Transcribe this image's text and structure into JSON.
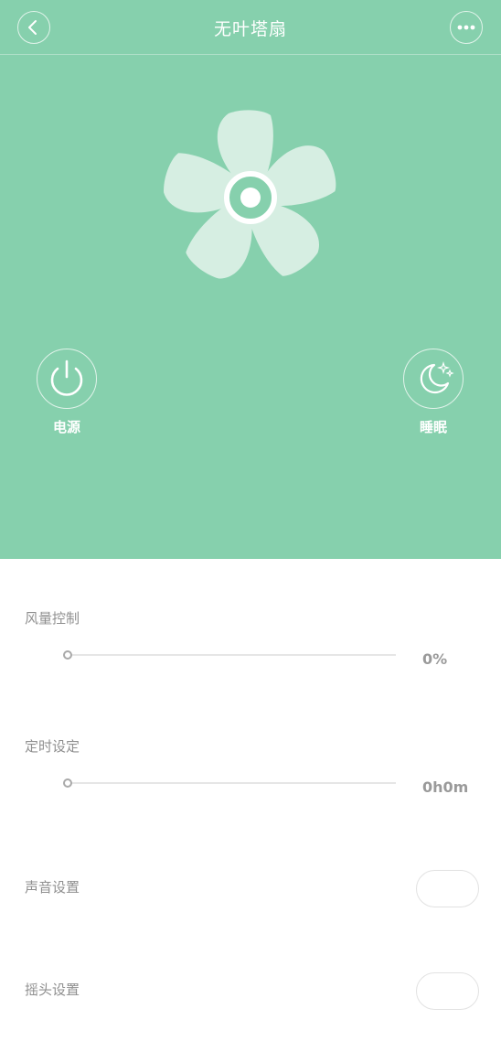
{
  "header": {
    "title": "无叶塔扇",
    "back_icon": "chevron-left-icon",
    "more_icon": "more-dots-icon"
  },
  "fan": {
    "icon": "fan-icon"
  },
  "controls": {
    "power": {
      "label": "电源",
      "icon": "power-icon"
    },
    "sleep": {
      "label": "睡眠",
      "icon": "moon-stars-icon"
    }
  },
  "wind": {
    "label": "风量控制",
    "value": "0%",
    "level": 0
  },
  "timer": {
    "label": "定时设定",
    "value": "0h0m",
    "level": 0
  },
  "sound": {
    "label": "声音设置",
    "enabled": false
  },
  "swing": {
    "label": "摇头设置",
    "enabled": false
  },
  "colors": {
    "theme_green": "#86d0ad",
    "text_gray": "#8f8f8f",
    "track_gray": "#e6e6e6"
  }
}
